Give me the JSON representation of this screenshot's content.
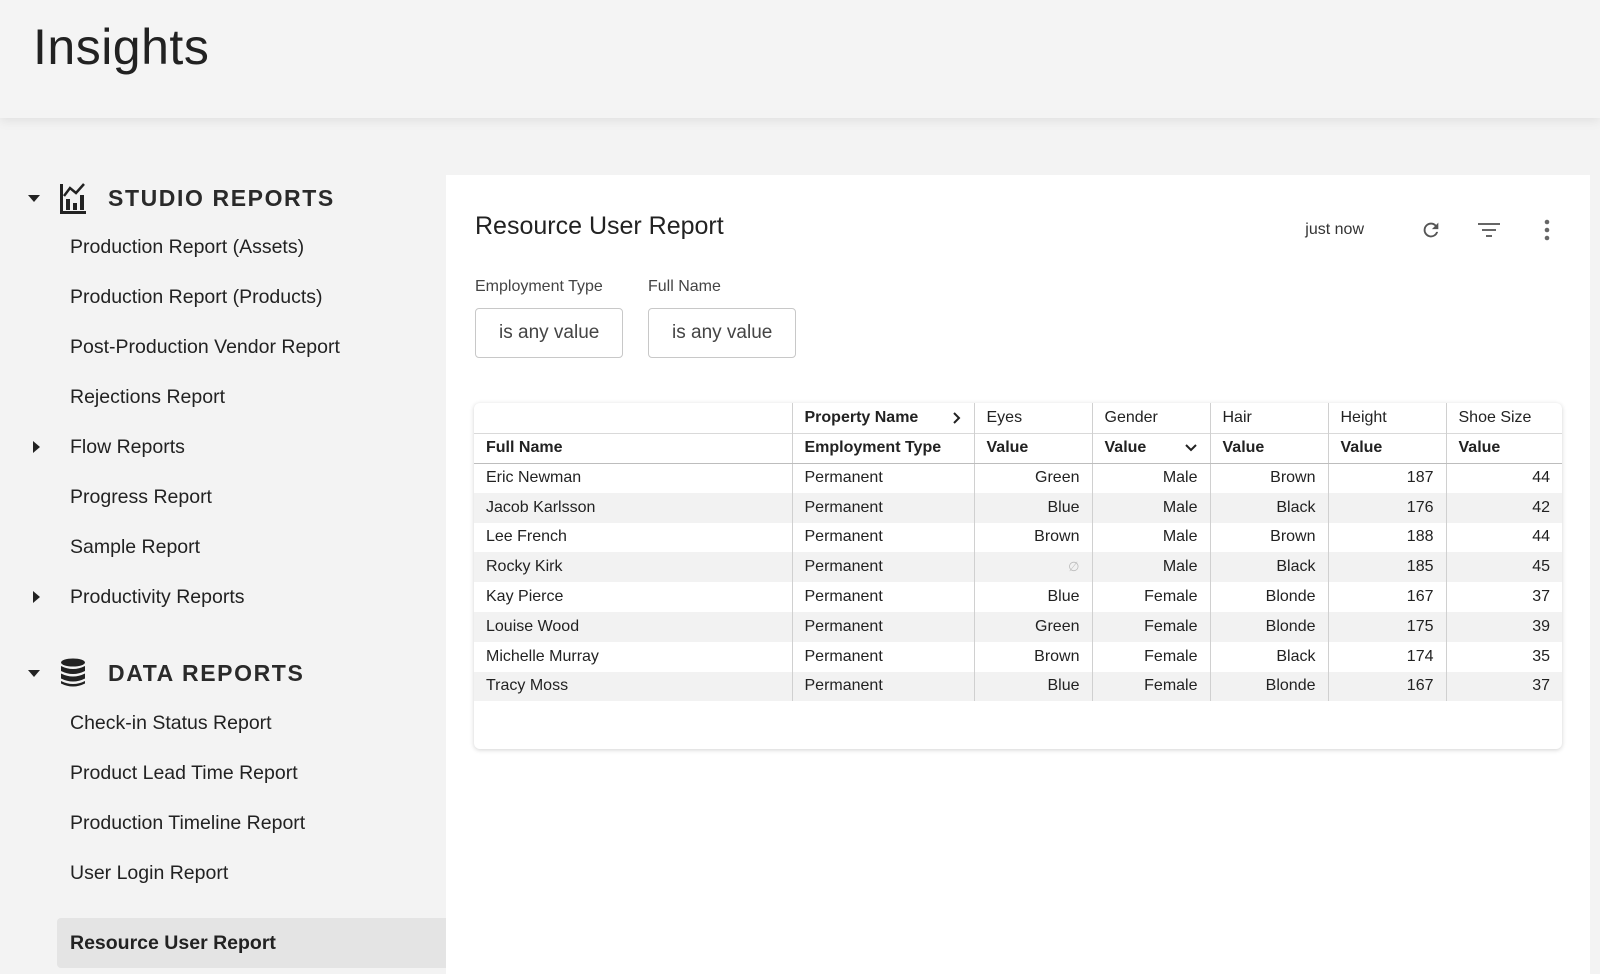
{
  "app": {
    "title": "Insights"
  },
  "sidebar": {
    "studio": {
      "label": "STUDIO REPORTS",
      "icon": "bar-chart-icon",
      "items": [
        {
          "label": "Production Report (Assets)"
        },
        {
          "label": "Production Report (Products)"
        },
        {
          "label": "Post-Production Vendor Report"
        },
        {
          "label": "Rejections Report"
        },
        {
          "label": "Flow Reports",
          "expandable": true
        },
        {
          "label": "Progress Report"
        },
        {
          "label": "Sample Report"
        },
        {
          "label": "Productivity Reports",
          "expandable": true
        }
      ]
    },
    "data": {
      "label": "DATA REPORTS",
      "icon": "database-icon",
      "items": [
        {
          "label": "Check-in Status Report"
        },
        {
          "label": "Product Lead Time Report"
        },
        {
          "label": "Production Timeline Report"
        },
        {
          "label": "User Login Report"
        },
        {
          "label": "Resource User Report",
          "active": true
        }
      ]
    }
  },
  "report": {
    "title": "Resource User Report",
    "updated": "just now",
    "filters": [
      {
        "label": "Employment Type",
        "value": "is any value"
      },
      {
        "label": "Full Name",
        "value": "is any value"
      }
    ],
    "table": {
      "pivot_header": "Property Name",
      "pivot_columns": [
        "Eyes",
        "Gender",
        "Hair",
        "Height",
        "Shoe Size"
      ],
      "columns": [
        "Full Name",
        "Employment Type",
        "Value",
        "Value",
        "Value",
        "Value",
        "Value"
      ],
      "rows": [
        [
          "Eric Newman",
          "Permanent",
          "Green",
          "Male",
          "Brown",
          "187",
          "44"
        ],
        [
          "Jacob Karlsson",
          "Permanent",
          "Blue",
          "Male",
          "Black",
          "176",
          "42"
        ],
        [
          "Lee French",
          "Permanent",
          "Brown",
          "Male",
          "Brown",
          "188",
          "44"
        ],
        [
          "Rocky Kirk",
          "Permanent",
          "∅",
          "Male",
          "Black",
          "185",
          "45"
        ],
        [
          "Kay Pierce",
          "Permanent",
          "Blue",
          "Female",
          "Blonde",
          "167",
          "37"
        ],
        [
          "Louise Wood",
          "Permanent",
          "Green",
          "Female",
          "Blonde",
          "175",
          "39"
        ],
        [
          "Michelle Murray",
          "Permanent",
          "Brown",
          "Female",
          "Black",
          "174",
          "35"
        ],
        [
          "Tracy Moss",
          "Permanent",
          "Blue",
          "Female",
          "Blonde",
          "167",
          "37"
        ]
      ]
    }
  },
  "colors": {
    "page_bg": "#f3f3f3",
    "active_nav": "#e4e4e4",
    "stripe": "#f2f2f2"
  }
}
